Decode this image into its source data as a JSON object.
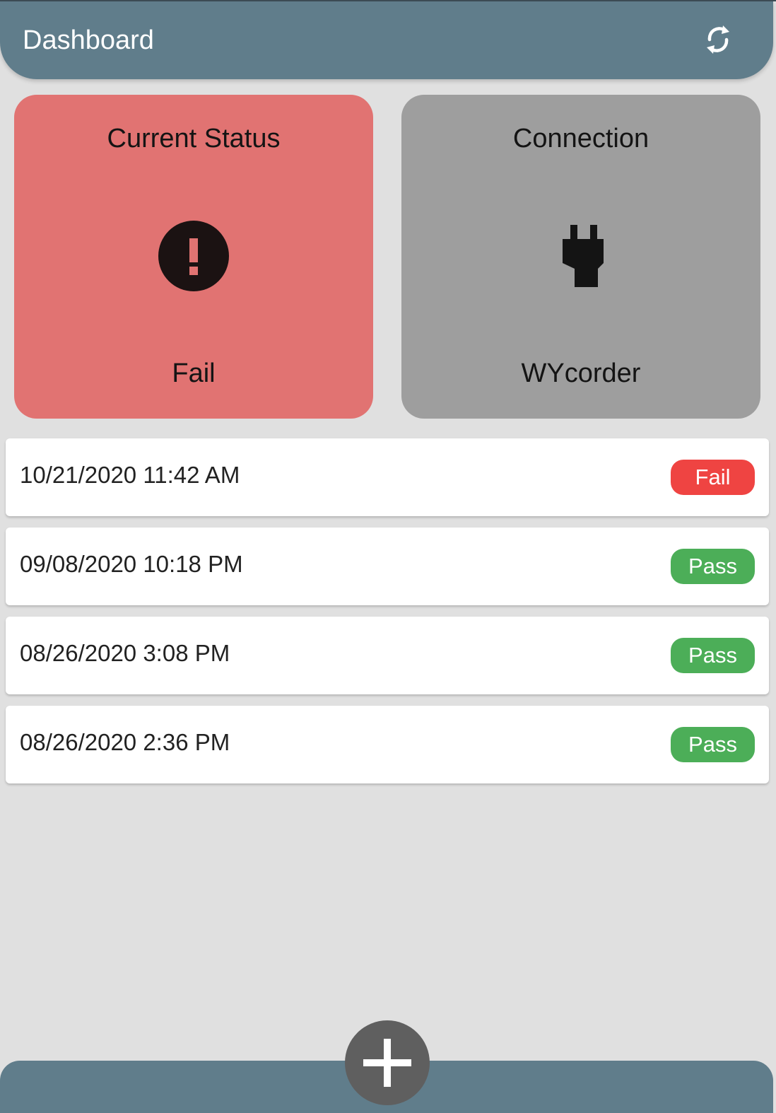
{
  "header": {
    "title": "Dashboard",
    "refresh_icon": "refresh-icon"
  },
  "cards": {
    "status": {
      "title": "Current Status",
      "value": "Fail",
      "icon": "exclamation-circle-icon",
      "color": "#e17372"
    },
    "connection": {
      "title": "Connection",
      "value": "WYcorder",
      "icon": "plug-icon",
      "color": "#9e9e9e"
    }
  },
  "history": [
    {
      "date": "10/21/2020 11:42 AM",
      "result": "Fail",
      "color": "#ef4442"
    },
    {
      "date": "09/08/2020 10:18 PM",
      "result": "Pass",
      "color": "#4cae58"
    },
    {
      "date": "08/26/2020 3:08 PM",
      "result": "Pass",
      "color": "#4cae58"
    },
    {
      "date": "08/26/2020 2:36 PM",
      "result": "Pass",
      "color": "#4cae58"
    }
  ],
  "footer": {
    "add_icon": "plus-icon"
  },
  "colors": {
    "header": "#607d8b",
    "background": "#e0e0e0",
    "fab": "#5f5f5f"
  }
}
